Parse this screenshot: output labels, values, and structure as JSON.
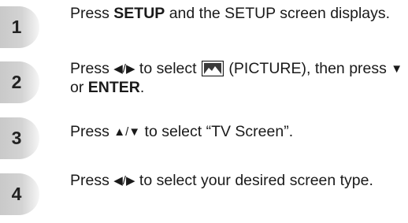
{
  "steps": [
    {
      "number": "1",
      "parts": [
        "Press ",
        "SETUP",
        " and the SETUP screen displays."
      ]
    },
    {
      "number": "2",
      "parts": [
        "Press ",
        "◀/▶",
        " to select ",
        "(PICTURE), then press ",
        "▼",
        " or ",
        "ENTER",
        "."
      ],
      "icon": "picture-menu-icon"
    },
    {
      "number": "3",
      "parts": [
        "Press ",
        "▲/▼",
        " to select “TV Screen”."
      ]
    },
    {
      "number": "4",
      "parts": [
        "Press ",
        "◀/▶",
        " to select your desired screen type."
      ]
    }
  ],
  "colors": {
    "badge_gradient_start": "#c9c9c9",
    "badge_gradient_end": "#f6f6f6",
    "text": "#1a1a1a"
  }
}
